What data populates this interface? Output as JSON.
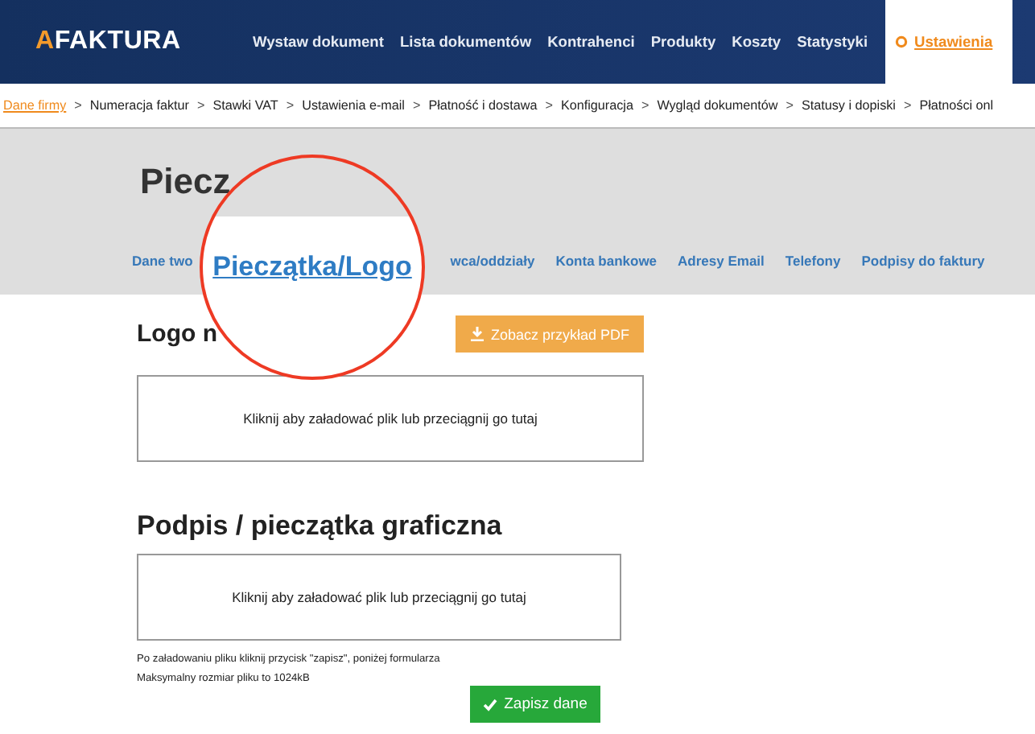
{
  "header": {
    "logo_accent": "A",
    "logo_rest": "FAKTURA",
    "nav": [
      {
        "label": "Wystaw dokument",
        "selected": false
      },
      {
        "label": "Lista dokumentów",
        "selected": false
      },
      {
        "label": "Kontrahenci",
        "selected": false
      },
      {
        "label": "Produkty",
        "selected": false
      },
      {
        "label": "Koszty",
        "selected": false
      },
      {
        "label": "Statystyki",
        "selected": false
      },
      {
        "label": "Ustawienia",
        "selected": true
      }
    ]
  },
  "breadcrumb": {
    "separator": ">",
    "items": [
      {
        "label": "Dane firmy",
        "selected": true
      },
      {
        "label": "Numeracja faktur",
        "selected": false
      },
      {
        "label": "Stawki VAT",
        "selected": false
      },
      {
        "label": "Ustawienia e-mail",
        "selected": false
      },
      {
        "label": "Płatność i dostawa",
        "selected": false
      },
      {
        "label": "Konfiguracja",
        "selected": false
      },
      {
        "label": "Wygląd dokumentów",
        "selected": false
      },
      {
        "label": "Statusy i dopiski",
        "selected": false
      },
      {
        "label": "Płatności onl",
        "selected": false
      }
    ]
  },
  "page_title": "Piecz",
  "subtabs": [
    "Dane two",
    "wca/oddziały",
    "Konta bankowe",
    "Adresy Email",
    "Telefony",
    "Podpisy do faktury"
  ],
  "magnifier": {
    "text": "Pieczątka/Logo"
  },
  "sections": [
    {
      "heading": "Logo n",
      "button": "Zobacz przykład PDF",
      "dropzone": "Kliknij aby załadować plik lub przeciągnij go tutaj"
    },
    {
      "heading": "Podpis / pieczątka graficzna",
      "dropzone": "Kliknij aby załadować plik lub przeciągnij go tutaj"
    }
  ],
  "notes": [
    "Po załadowaniu pliku kliknij przycisk \"zapisz\", poniżej formularza",
    "Maksymalny rozmiar pliku to 1024kB"
  ],
  "save_button": "Zapisz dane"
}
